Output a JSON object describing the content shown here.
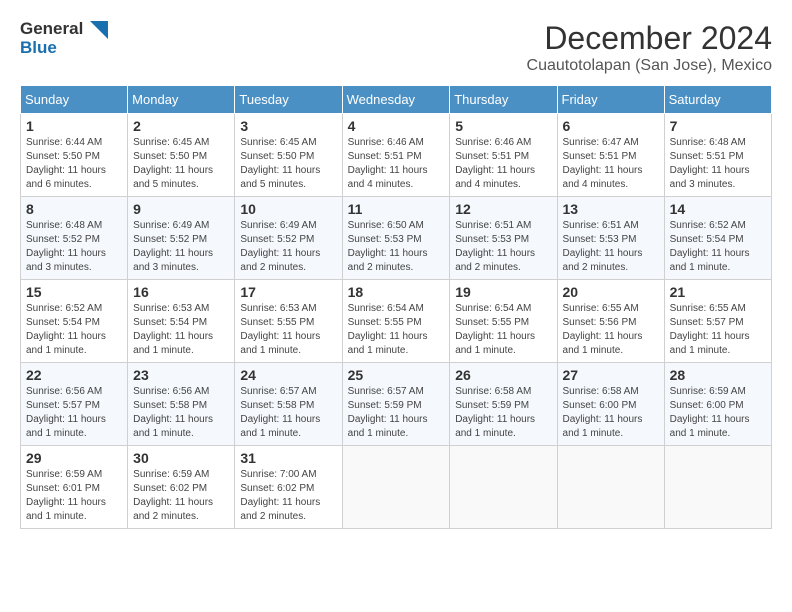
{
  "header": {
    "logo_line1": "General",
    "logo_line2": "Blue",
    "month": "December 2024",
    "location": "Cuautotolapan (San Jose), Mexico"
  },
  "days_of_week": [
    "Sunday",
    "Monday",
    "Tuesday",
    "Wednesday",
    "Thursday",
    "Friday",
    "Saturday"
  ],
  "weeks": [
    [
      {
        "day": "1",
        "sunrise": "6:44 AM",
        "sunset": "5:50 PM",
        "daylight": "11 hours and 6 minutes."
      },
      {
        "day": "2",
        "sunrise": "6:45 AM",
        "sunset": "5:50 PM",
        "daylight": "11 hours and 5 minutes."
      },
      {
        "day": "3",
        "sunrise": "6:45 AM",
        "sunset": "5:50 PM",
        "daylight": "11 hours and 5 minutes."
      },
      {
        "day": "4",
        "sunrise": "6:46 AM",
        "sunset": "5:51 PM",
        "daylight": "11 hours and 4 minutes."
      },
      {
        "day": "5",
        "sunrise": "6:46 AM",
        "sunset": "5:51 PM",
        "daylight": "11 hours and 4 minutes."
      },
      {
        "day": "6",
        "sunrise": "6:47 AM",
        "sunset": "5:51 PM",
        "daylight": "11 hours and 4 minutes."
      },
      {
        "day": "7",
        "sunrise": "6:48 AM",
        "sunset": "5:51 PM",
        "daylight": "11 hours and 3 minutes."
      }
    ],
    [
      {
        "day": "8",
        "sunrise": "6:48 AM",
        "sunset": "5:52 PM",
        "daylight": "11 hours and 3 minutes."
      },
      {
        "day": "9",
        "sunrise": "6:49 AM",
        "sunset": "5:52 PM",
        "daylight": "11 hours and 3 minutes."
      },
      {
        "day": "10",
        "sunrise": "6:49 AM",
        "sunset": "5:52 PM",
        "daylight": "11 hours and 2 minutes."
      },
      {
        "day": "11",
        "sunrise": "6:50 AM",
        "sunset": "5:53 PM",
        "daylight": "11 hours and 2 minutes."
      },
      {
        "day": "12",
        "sunrise": "6:51 AM",
        "sunset": "5:53 PM",
        "daylight": "11 hours and 2 minutes."
      },
      {
        "day": "13",
        "sunrise": "6:51 AM",
        "sunset": "5:53 PM",
        "daylight": "11 hours and 2 minutes."
      },
      {
        "day": "14",
        "sunrise": "6:52 AM",
        "sunset": "5:54 PM",
        "daylight": "11 hours and 1 minute."
      }
    ],
    [
      {
        "day": "15",
        "sunrise": "6:52 AM",
        "sunset": "5:54 PM",
        "daylight": "11 hours and 1 minute."
      },
      {
        "day": "16",
        "sunrise": "6:53 AM",
        "sunset": "5:54 PM",
        "daylight": "11 hours and 1 minute."
      },
      {
        "day": "17",
        "sunrise": "6:53 AM",
        "sunset": "5:55 PM",
        "daylight": "11 hours and 1 minute."
      },
      {
        "day": "18",
        "sunrise": "6:54 AM",
        "sunset": "5:55 PM",
        "daylight": "11 hours and 1 minute."
      },
      {
        "day": "19",
        "sunrise": "6:54 AM",
        "sunset": "5:55 PM",
        "daylight": "11 hours and 1 minute."
      },
      {
        "day": "20",
        "sunrise": "6:55 AM",
        "sunset": "5:56 PM",
        "daylight": "11 hours and 1 minute."
      },
      {
        "day": "21",
        "sunrise": "6:55 AM",
        "sunset": "5:57 PM",
        "daylight": "11 hours and 1 minute."
      }
    ],
    [
      {
        "day": "22",
        "sunrise": "6:56 AM",
        "sunset": "5:57 PM",
        "daylight": "11 hours and 1 minute."
      },
      {
        "day": "23",
        "sunrise": "6:56 AM",
        "sunset": "5:58 PM",
        "daylight": "11 hours and 1 minute."
      },
      {
        "day": "24",
        "sunrise": "6:57 AM",
        "sunset": "5:58 PM",
        "daylight": "11 hours and 1 minute."
      },
      {
        "day": "25",
        "sunrise": "6:57 AM",
        "sunset": "5:59 PM",
        "daylight": "11 hours and 1 minute."
      },
      {
        "day": "26",
        "sunrise": "6:58 AM",
        "sunset": "5:59 PM",
        "daylight": "11 hours and 1 minute."
      },
      {
        "day": "27",
        "sunrise": "6:58 AM",
        "sunset": "6:00 PM",
        "daylight": "11 hours and 1 minute."
      },
      {
        "day": "28",
        "sunrise": "6:59 AM",
        "sunset": "6:00 PM",
        "daylight": "11 hours and 1 minute."
      }
    ],
    [
      {
        "day": "29",
        "sunrise": "6:59 AM",
        "sunset": "6:01 PM",
        "daylight": "11 hours and 1 minute."
      },
      {
        "day": "30",
        "sunrise": "6:59 AM",
        "sunset": "6:02 PM",
        "daylight": "11 hours and 2 minutes."
      },
      {
        "day": "31",
        "sunrise": "7:00 AM",
        "sunset": "6:02 PM",
        "daylight": "11 hours and 2 minutes."
      },
      null,
      null,
      null,
      null
    ]
  ],
  "labels": {
    "sunrise": "Sunrise: ",
    "sunset": "Sunset: ",
    "daylight": "Daylight: "
  }
}
